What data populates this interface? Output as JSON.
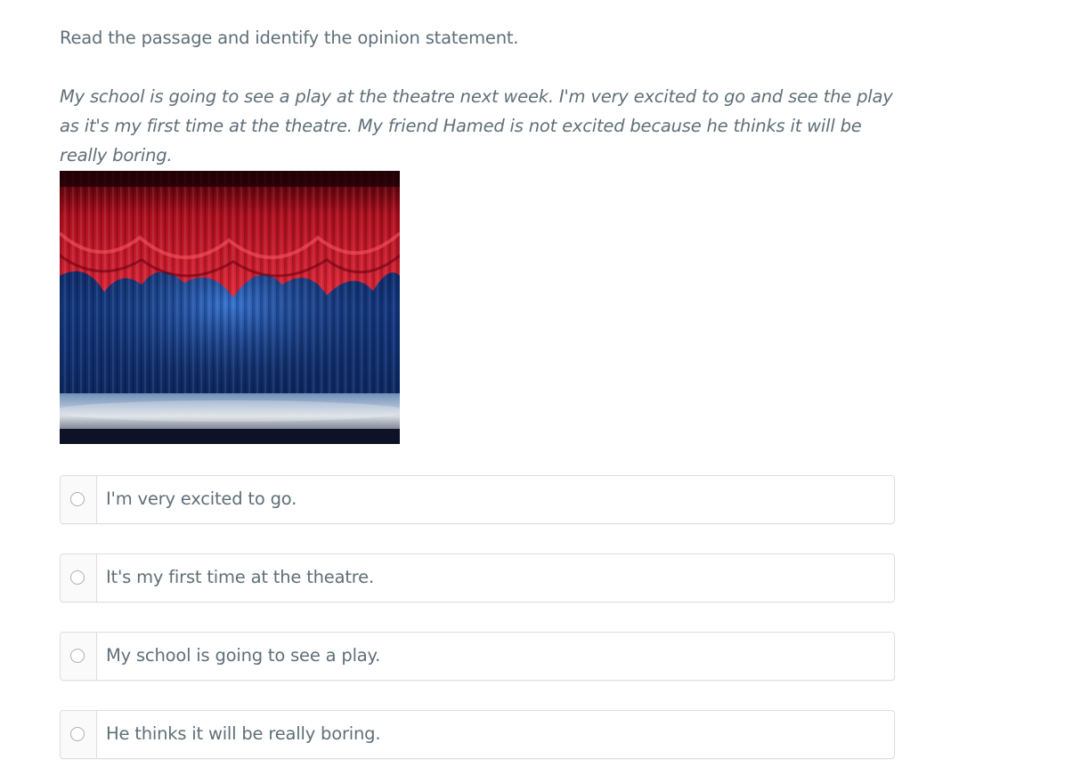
{
  "question": {
    "instruction": "Read the passage and identify the opinion statement.",
    "passage": "My school is going to see a play at the theatre next week. I'm very excited to go and see the play as it's my first time at the theatre. My friend Hamed is not excited because he thinks it will be really boring."
  },
  "image": {
    "subject": "theatre stage with red curtains"
  },
  "colors": {
    "text": "#5f6f78",
    "border": "#dcdfe2",
    "curtain_red": "#c8102e",
    "curtain_blue": "#1e4fa0"
  },
  "options": [
    {
      "label": "I'm very excited to go.",
      "selected": false
    },
    {
      "label": "It's my first time at the theatre.",
      "selected": false
    },
    {
      "label": "My school is going to see a play.",
      "selected": false
    },
    {
      "label": "He thinks it will be really boring.",
      "selected": false
    }
  ]
}
